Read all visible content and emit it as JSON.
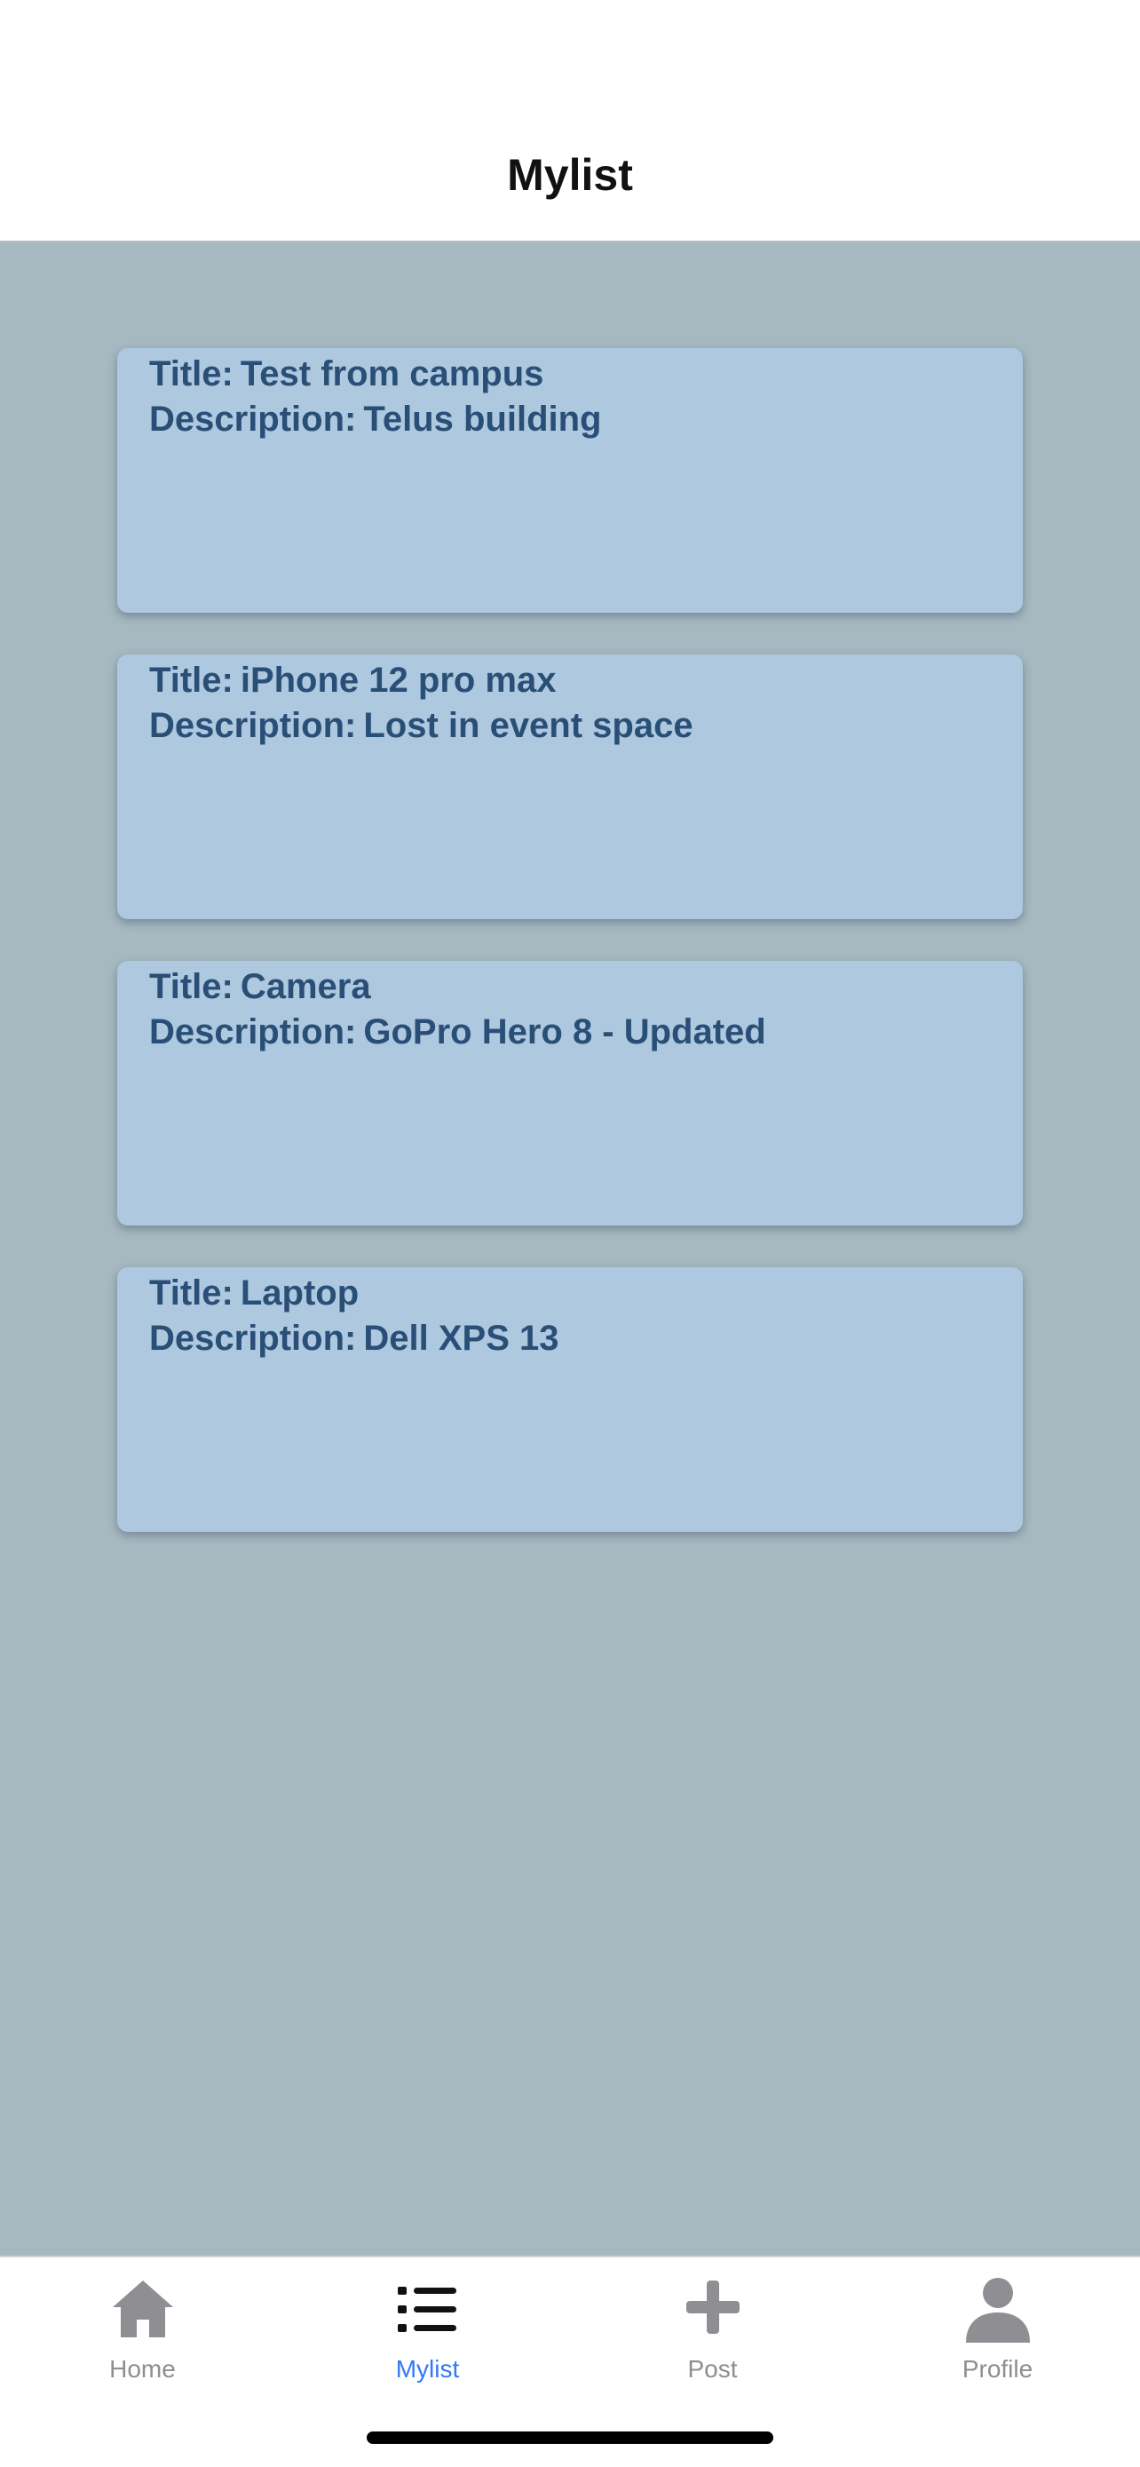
{
  "header": {
    "title": "Mylist"
  },
  "cards": [
    {
      "title_label": "Title:",
      "title": "Test from campus",
      "description_label": "Description:",
      "description": "Telus building"
    },
    {
      "title_label": "Title:",
      "title": "iPhone 12 pro max",
      "description_label": "Description:",
      "description": "Lost in event space"
    },
    {
      "title_label": "Title:",
      "title": "Camera",
      "description_label": "Description:",
      "description": "GoPro Hero 8 - Updated"
    },
    {
      "title_label": "Title:",
      "title": "Laptop",
      "description_label": "Description:",
      "description": "Dell XPS 13"
    }
  ],
  "tabs": [
    {
      "label": "Home",
      "icon": "home-icon",
      "active": false
    },
    {
      "label": "Mylist",
      "icon": "list-icon",
      "active": true
    },
    {
      "label": "Post",
      "icon": "plus-icon",
      "active": false
    },
    {
      "label": "Profile",
      "icon": "person-icon",
      "active": false
    }
  ],
  "colors": {
    "background": "#a6b8c0",
    "card": "#adc8df",
    "card_text": "#2a4f77",
    "tab_active": "#3478f6",
    "tab_inactive": "#8e8e93"
  }
}
